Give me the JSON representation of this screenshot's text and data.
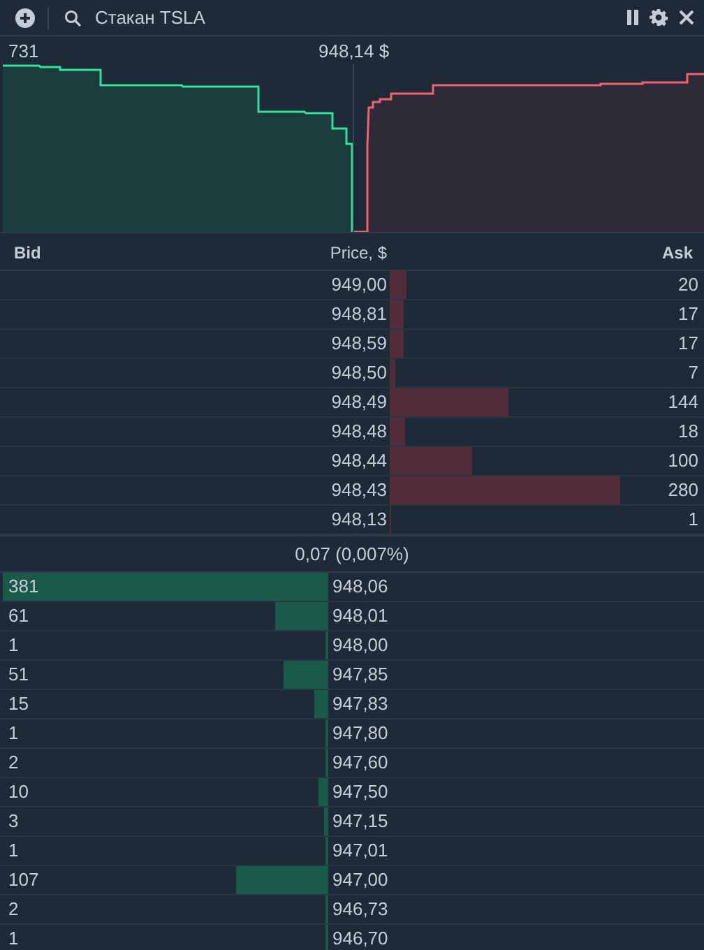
{
  "header": {
    "title": "Стакан TSLA"
  },
  "depth": {
    "volume": "731",
    "mid_price": "948,14 $"
  },
  "columns": {
    "bid": "Bid",
    "price": "Price, $",
    "ask": "Ask"
  },
  "asks": [
    {
      "price": "949,00",
      "size": "20"
    },
    {
      "price": "948,81",
      "size": "17"
    },
    {
      "price": "948,59",
      "size": "17"
    },
    {
      "price": "948,50",
      "size": "7"
    },
    {
      "price": "948,49",
      "size": "144"
    },
    {
      "price": "948,48",
      "size": "18"
    },
    {
      "price": "948,44",
      "size": "100"
    },
    {
      "price": "948,43",
      "size": "280"
    },
    {
      "price": "948,13",
      "size": "1"
    }
  ],
  "spread": "0,07 (0,007%)",
  "bids": [
    {
      "price": "948,06",
      "size": "381",
      "level": 1
    },
    {
      "price": "948,01",
      "size": "61",
      "level": 0.16
    },
    {
      "price": "948,00",
      "size": "1",
      "level": 0.004
    },
    {
      "price": "947,85",
      "size": "51",
      "level": 0.133
    },
    {
      "price": "947,83",
      "size": "15",
      "level": 0.039
    },
    {
      "price": "947,80",
      "size": "1",
      "level": 0.004
    },
    {
      "price": "947,60",
      "size": "2",
      "level": 0.005
    },
    {
      "price": "947,50",
      "size": "10",
      "level": 0.026
    },
    {
      "price": "947,15",
      "size": "3",
      "level": 0.009
    },
    {
      "price": "947,01",
      "size": "1",
      "level": 0.004
    },
    {
      "price": "947,00",
      "size": "107",
      "level": 0.28
    },
    {
      "price": "946,73",
      "size": "2",
      "level": 0.005
    },
    {
      "price": "946,70",
      "size": "1",
      "level": 0.004
    }
  ]
}
